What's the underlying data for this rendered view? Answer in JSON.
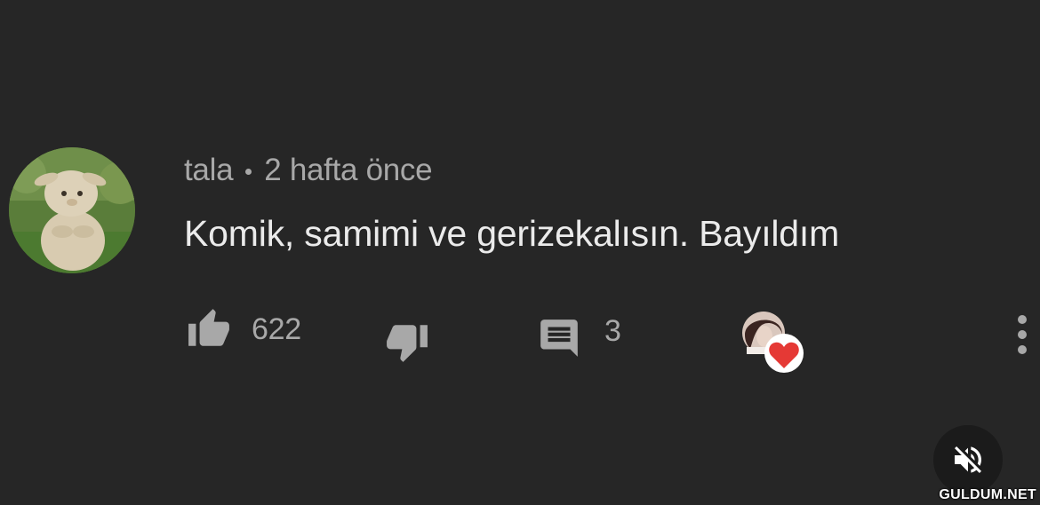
{
  "comment": {
    "author": "tala",
    "separator": "•",
    "time": "2 hafta önce",
    "text": "Komik, samimi ve gerizekalısın. Bayıldım"
  },
  "actions": {
    "like_count": "622",
    "reply_count": "3",
    "hearted_by_creator": true
  },
  "icons": {
    "like": "thumb-up-icon",
    "dislike": "thumb-down-icon",
    "reply": "comment-icon",
    "heart": "heart-icon",
    "menu": "more-vert-icon",
    "mute": "volume-off-icon"
  },
  "colors": {
    "background": "#262626",
    "text_primary": "#ebebeb",
    "text_secondary": "#a8a8a8",
    "heart": "#e53935"
  },
  "watermark": "GULDUM.NET"
}
